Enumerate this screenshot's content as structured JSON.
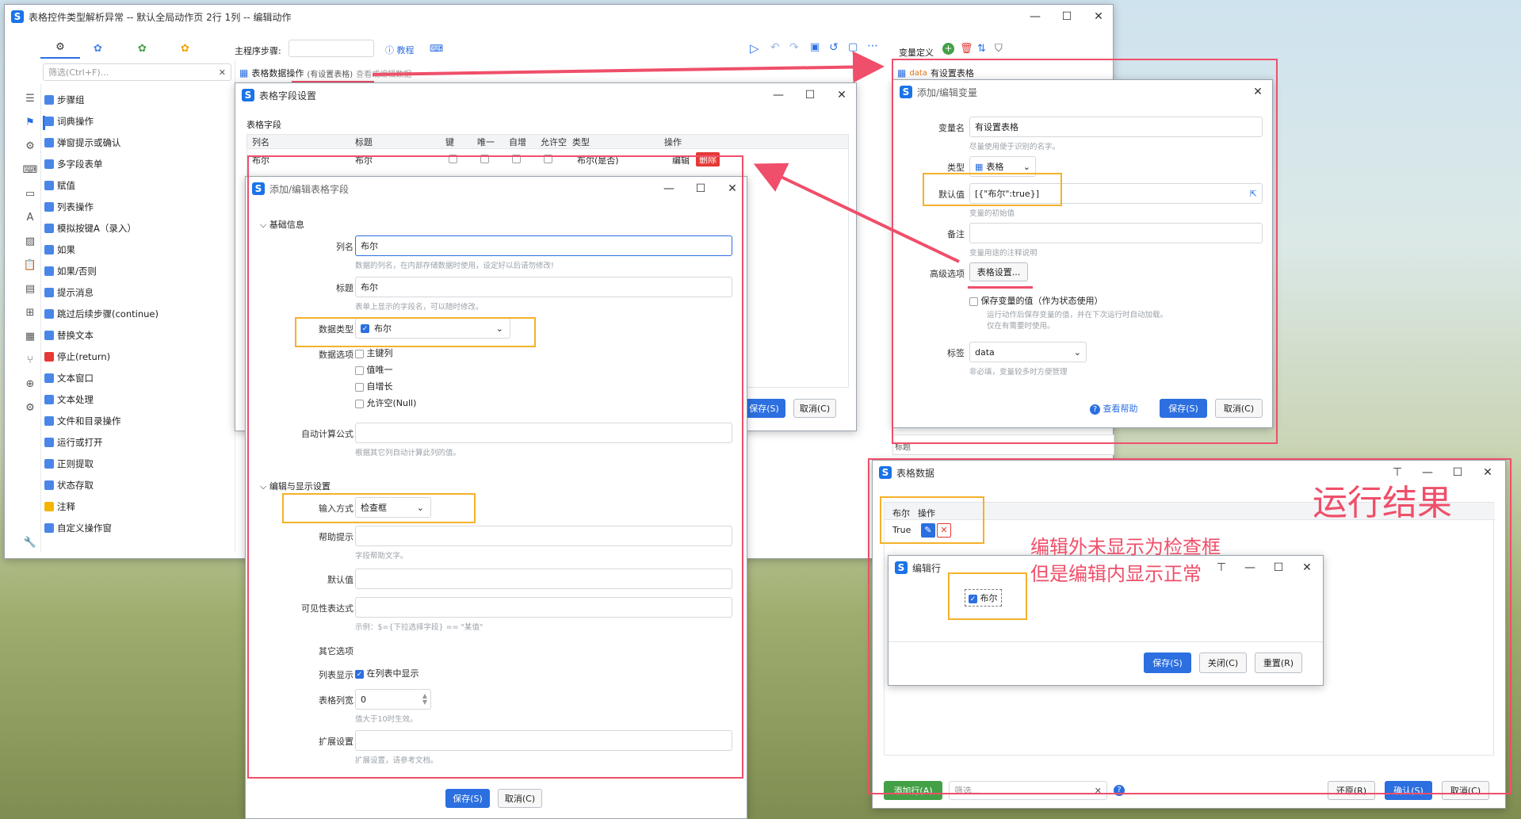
{
  "main_window": {
    "title": "表格控件类型解析异常 -- 默认全局动作页 2行 1列 -- 编辑动作",
    "step_label": "主程序步骤:",
    "tutorial": "教程",
    "filter_placeholder": "筛选(Ctrl+F)...",
    "tab_label": "表格数据操作",
    "tab_sub": "(有设置表格)",
    "tab_hint": "查看或编辑数据",
    "var_def_label": "变量定义",
    "var_row_tag": "data",
    "var_row_name": "有设置表格",
    "sidebar_items": [
      {
        "label": "步骤组",
        "color": "#4a86e8"
      },
      {
        "label": "词典操作",
        "color": "#4a86e8"
      },
      {
        "label": "弹窗提示或确认",
        "color": "#4a86e8"
      },
      {
        "label": "多字段表单",
        "color": "#4a86e8"
      },
      {
        "label": "赋值",
        "color": "#4a86e8"
      },
      {
        "label": "列表操作",
        "color": "#4a86e8"
      },
      {
        "label": "模拟按键A（录入）",
        "color": "#4a86e8"
      },
      {
        "label": "如果",
        "color": "#4a86e8"
      },
      {
        "label": "如果/否则",
        "color": "#4a86e8"
      },
      {
        "label": "提示消息",
        "color": "#4a86e8"
      },
      {
        "label": "跳过后续步骤(continue)",
        "color": "#4a86e8"
      },
      {
        "label": "替换文本",
        "color": "#4a86e8"
      },
      {
        "label": "停止(return)",
        "color": "#e53935"
      },
      {
        "label": "文本窗口",
        "color": "#4a86e8"
      },
      {
        "label": "文本处理",
        "color": "#4a86e8"
      },
      {
        "label": "文件和目录操作",
        "color": "#4a86e8"
      },
      {
        "label": "运行或打开",
        "color": "#4a86e8"
      },
      {
        "label": "正则提取",
        "color": "#4a86e8"
      },
      {
        "label": "状态存取",
        "color": "#4a86e8"
      },
      {
        "label": "注释",
        "color": "#f4b400"
      },
      {
        "label": "自定义操作窗",
        "color": "#4a86e8"
      }
    ]
  },
  "field_settings": {
    "title": "表格字段设置",
    "section": "表格字段",
    "headers": [
      "列名",
      "标题",
      "键",
      "唯一",
      "自增",
      "允许空",
      "类型",
      "操作"
    ],
    "row": {
      "name": "布尔",
      "title": "布尔",
      "type": "布尔(是否)",
      "edit": "编辑",
      "delete": "删除"
    },
    "save": "保存(S)",
    "cancel": "取消(C)"
  },
  "field_edit": {
    "title": "添加/编辑表格字段",
    "basic_section": "基础信息",
    "col_name_label": "列名",
    "col_name_value": "布尔",
    "col_name_hint": "数据的列名，在内部存储数据时使用，设定好以后请勿修改!",
    "title_label": "标题",
    "title_value": "布尔",
    "title_hint": "表单上显示的字段名，可以随时修改。",
    "dtype_label": "数据类型",
    "dtype_value": "布尔",
    "dopts_label": "数据选项",
    "dopts": [
      "主键列",
      "值唯一",
      "自增长",
      "允许空(Null)"
    ],
    "formula_label": "自动计算公式",
    "formula_hint": "根据其它列自动计算此列的值。",
    "edit_section": "编辑与显示设置",
    "input_label": "输入方式",
    "input_value": "检查框",
    "help_label": "帮助提示",
    "help_hint": "字段帮助文字。",
    "default_label": "默认值",
    "visible_label": "可见性表达式",
    "visible_hint": "示例：$={下拉选择字段} == \"某值\"",
    "other_label": "其它选项",
    "listshow_label": "列表显示",
    "listshow_value": "在列表中显示",
    "width_label": "表格列宽",
    "width_value": "0",
    "width_hint": "值大于10时生效。",
    "ext_label": "扩展设置",
    "ext_hint": "扩展设置，请参考文档。",
    "save": "保存(S)",
    "cancel": "取消(C)"
  },
  "var_edit": {
    "title": "添加/编辑变量",
    "name_label": "变量名",
    "name_value": "有设置表格",
    "name_hint": "尽量使用便于识别的名字。",
    "type_label": "类型",
    "type_value": "表格",
    "default_label": "默认值",
    "default_value": "[{\"布尔\":true}]",
    "default_hint": "变量的初始值",
    "remark_label": "备注",
    "remark_hint": "变量用途的注释说明",
    "adv_label": "高级选项",
    "adv_btn": "表格设置...",
    "save_state": "保存变量的值（作为状态使用）",
    "save_state_hint1": "运行动作后保存变量的值，并在下次运行时自动加载。",
    "save_state_hint2": "仅在有需要时使用。",
    "tag_label": "标签",
    "tag_value": "data",
    "tag_hint": "非必填，变量较多时方便管理",
    "help": "查看帮助",
    "save": "保存(S)",
    "cancel": "取消(C)",
    "under_label": "标题"
  },
  "table_data": {
    "title": "表格数据",
    "col1": "布尔",
    "col2": "操作",
    "cell": "True",
    "add_row": "添加行(A)",
    "filter_placeholder": "筛选...",
    "restore": "还原(R)",
    "confirm": "确认(S)",
    "cancel": "取消(C)"
  },
  "edit_row": {
    "title": "编辑行",
    "field": "布尔",
    "save": "保存(S)",
    "close": "关闭(C)",
    "reset": "重置(R)"
  },
  "annotations": {
    "result": "运行结果",
    "note1": "编辑外未显示为检查框",
    "note2": "但是编辑内显示正常"
  }
}
